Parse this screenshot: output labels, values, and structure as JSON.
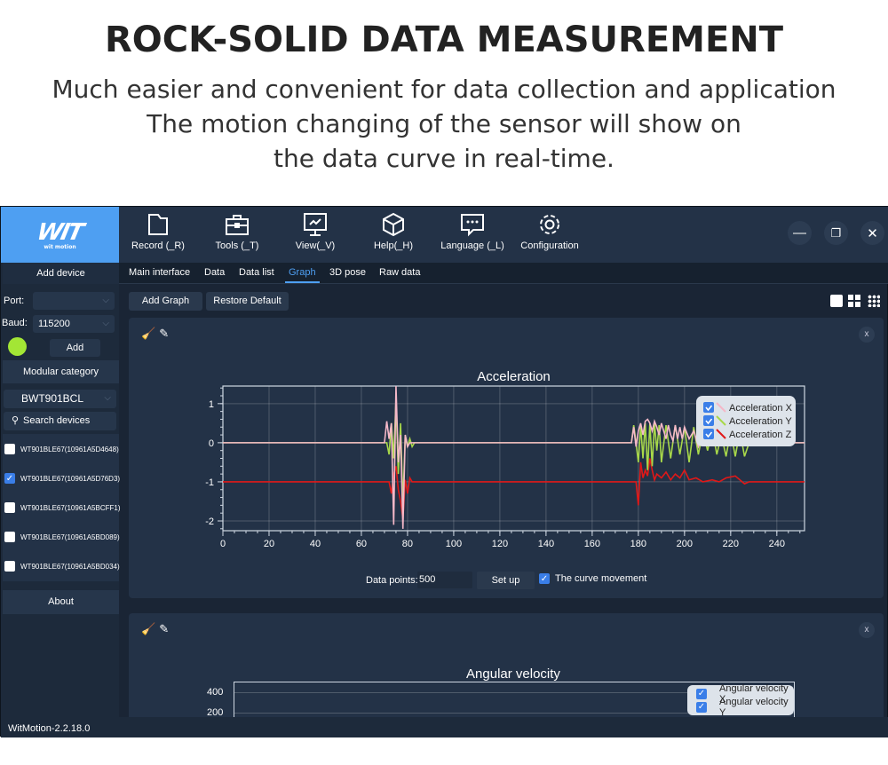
{
  "hero": {
    "title": "ROCK-SOLID DATA MEASUREMENT",
    "lines": [
      "Much easier and convenient for data collection and application",
      "The motion changing of the sensor will show on",
      "the data curve in real-time."
    ]
  },
  "app": {
    "logo": {
      "big": "WIT",
      "small": "wit motion"
    },
    "toolbar": [
      {
        "label": "Record (_R)",
        "icon": "folder-icon"
      },
      {
        "label": "Tools (_T)",
        "icon": "toolbox-icon"
      },
      {
        "label": "View(_V)",
        "icon": "monitor-chart-icon"
      },
      {
        "label": "Help(_H)",
        "icon": "cube-icon"
      },
      {
        "label": "Language (_L)",
        "icon": "chat-icon"
      },
      {
        "label": "Configuration",
        "icon": "gear-icon"
      }
    ],
    "window_controls": {
      "minimize": "—",
      "restore": "❐",
      "close": "✕"
    },
    "sidebar": {
      "add_device": "Add device",
      "port_label": "Port:",
      "port_value": "",
      "baud_label": "Baud:",
      "baud_value": "115200",
      "status_color": "#a3e635",
      "add_button": "Add",
      "modular_category": "Modular category",
      "category_value": "BWT901BCL",
      "search_devices": "Search devices",
      "devices": [
        {
          "name": "WT901BLE67(10961A5D4648)",
          "checked": false
        },
        {
          "name": "WT901BLE67(10961A5D76D3)",
          "checked": true
        },
        {
          "name": "WT901BLE67(10961A5BCFF1)",
          "checked": false
        },
        {
          "name": "WT901BLE67(10961A5BD089)",
          "checked": false
        },
        {
          "name": "WT901BLE67(10961A5BD034)",
          "checked": false
        }
      ],
      "about": "About"
    },
    "tabs": [
      {
        "label": "Main interface",
        "active": false
      },
      {
        "label": "Data",
        "active": false
      },
      {
        "label": "Data list",
        "active": false
      },
      {
        "label": "Graph",
        "active": true
      },
      {
        "label": "3D pose",
        "active": false
      },
      {
        "label": "Raw data",
        "active": false
      }
    ],
    "graph_toolbar": {
      "add_graph": "Add Graph",
      "restore_default": "Restore Default"
    },
    "panel1": {
      "close": "x",
      "data_points_label": "Data points:",
      "data_points_value": "500",
      "set_up": "Set up",
      "curve_movement_label": "The curve movement",
      "curve_movement_checked": true
    },
    "panel2": {
      "close": "x",
      "title": "Angular velocity",
      "yticks": [
        "400",
        "200"
      ],
      "legend": [
        "Angular velocity X",
        "Angular velocity Y"
      ]
    },
    "version": "WitMotion-2.2.18.0",
    "colors": {
      "accent": "#4e9ff2",
      "background": "#1a2535",
      "panel": "#233247"
    }
  },
  "chart_data": {
    "type": "line",
    "title": "Acceleration",
    "xlabel": "",
    "ylabel": "",
    "xlim": [
      0,
      252
    ],
    "ylim": [
      -2.25,
      1.45
    ],
    "xticks": [
      0,
      20,
      40,
      60,
      80,
      100,
      120,
      140,
      160,
      180,
      200,
      220,
      240
    ],
    "yticks": [
      1,
      0,
      -1,
      -2
    ],
    "grid": true,
    "legend": "top-right",
    "series": [
      {
        "name": "Acceleration X",
        "color": "#f4b8c8",
        "x": [
          0,
          70,
          71,
          72,
          73,
          74,
          75,
          76,
          77,
          78,
          79,
          80,
          81,
          177,
          178,
          179,
          180,
          181,
          182,
          183,
          184,
          185,
          186,
          187,
          188,
          189,
          190,
          191,
          192,
          193,
          194,
          195,
          196,
          197,
          198,
          199,
          200,
          202,
          204,
          206,
          208,
          210,
          212,
          215,
          218,
          222,
          252
        ],
        "y": [
          0,
          0,
          0.55,
          0.1,
          0.5,
          -2.1,
          1.45,
          -0.5,
          0.2,
          -2.2,
          0.2,
          -0.1,
          0,
          0,
          0.4,
          -0.1,
          0.3,
          0.5,
          0.2,
          0.55,
          0.6,
          0.5,
          0.3,
          0.55,
          0.4,
          0.2,
          0.5,
          0.3,
          0.1,
          0.45,
          0.2,
          0.05,
          0.45,
          0.1,
          0.4,
          0.1,
          0.4,
          0.1,
          0.3,
          -0.1,
          0.25,
          0,
          0.3,
          0,
          0.2,
          0,
          0
        ]
      },
      {
        "name": "Acceleration Y",
        "color": "#a8d84a",
        "x": [
          0,
          71,
          72,
          73,
          74,
          75,
          76,
          77,
          78,
          79,
          80,
          81,
          82,
          83,
          177,
          178,
          179,
          180,
          181,
          182,
          183,
          184,
          185,
          186,
          187,
          188,
          189,
          190,
          192,
          194,
          196,
          198,
          200,
          202,
          204,
          206,
          208,
          210,
          212,
          214,
          216,
          218,
          220,
          222,
          224,
          226,
          228,
          252
        ],
        "y": [
          0,
          0,
          -0.3,
          0.5,
          -0.4,
          1.1,
          -0.8,
          0.5,
          -1.6,
          0.2,
          -0.1,
          0.1,
          -0.1,
          0,
          0,
          0.45,
          0,
          -0.5,
          0.45,
          -0.4,
          0.5,
          -0.7,
          0.5,
          -0.6,
          0.5,
          -0.2,
          0.45,
          -0.5,
          0.45,
          -0.4,
          0.45,
          -0.3,
          0.4,
          -0.5,
          0.4,
          -0.3,
          0.3,
          -0.2,
          0.35,
          -0.3,
          0.2,
          -0.35,
          0.3,
          -0.35,
          0.3,
          -0.35,
          0,
          0
        ]
      },
      {
        "name": "Acceleration Z",
        "color": "#e01818",
        "x": [
          0,
          72,
          73,
          74,
          75,
          76,
          77,
          78,
          79,
          80,
          81,
          82,
          179,
          180,
          181,
          182,
          183,
          184,
          185,
          186,
          187,
          188,
          190,
          192,
          194,
          196,
          198,
          200,
          202,
          205,
          208,
          212,
          215,
          218,
          222,
          226,
          228,
          252
        ],
        "y": [
          -1,
          -1,
          -1.3,
          -0.8,
          -0.6,
          -1.2,
          -1.5,
          -1.95,
          -0.95,
          -1.3,
          -0.9,
          -1,
          -1,
          -1.6,
          -0.5,
          -0.9,
          -0.7,
          -0.85,
          -0.4,
          -0.7,
          -0.95,
          -0.8,
          -0.9,
          -0.75,
          -0.95,
          -0.8,
          -0.9,
          -0.7,
          -0.95,
          -0.9,
          -1,
          -0.95,
          -1,
          -0.9,
          -0.85,
          -1.05,
          -1,
          -1
        ]
      }
    ]
  }
}
